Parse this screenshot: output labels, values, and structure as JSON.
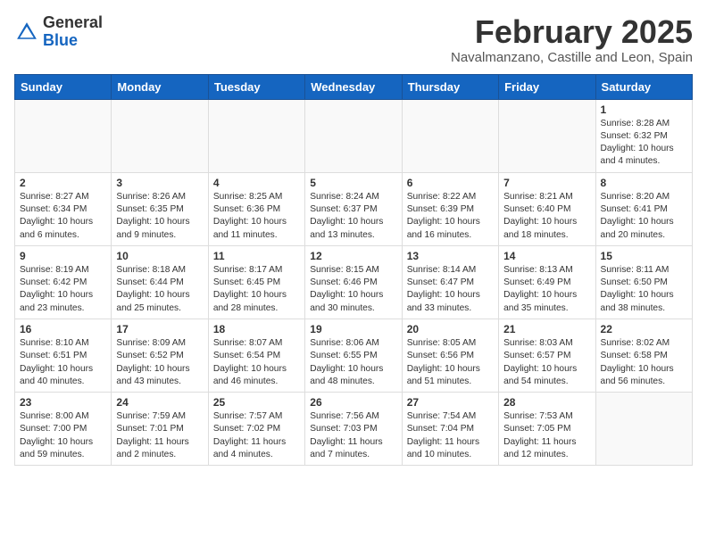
{
  "header": {
    "logo_general": "General",
    "logo_blue": "Blue",
    "month": "February 2025",
    "location": "Navalmanzano, Castille and Leon, Spain"
  },
  "weekdays": [
    "Sunday",
    "Monday",
    "Tuesday",
    "Wednesday",
    "Thursday",
    "Friday",
    "Saturday"
  ],
  "weeks": [
    [
      {
        "day": "",
        "info": ""
      },
      {
        "day": "",
        "info": ""
      },
      {
        "day": "",
        "info": ""
      },
      {
        "day": "",
        "info": ""
      },
      {
        "day": "",
        "info": ""
      },
      {
        "day": "",
        "info": ""
      },
      {
        "day": "1",
        "info": "Sunrise: 8:28 AM\nSunset: 6:32 PM\nDaylight: 10 hours\nand 4 minutes."
      }
    ],
    [
      {
        "day": "2",
        "info": "Sunrise: 8:27 AM\nSunset: 6:34 PM\nDaylight: 10 hours\nand 6 minutes."
      },
      {
        "day": "3",
        "info": "Sunrise: 8:26 AM\nSunset: 6:35 PM\nDaylight: 10 hours\nand 9 minutes."
      },
      {
        "day": "4",
        "info": "Sunrise: 8:25 AM\nSunset: 6:36 PM\nDaylight: 10 hours\nand 11 minutes."
      },
      {
        "day": "5",
        "info": "Sunrise: 8:24 AM\nSunset: 6:37 PM\nDaylight: 10 hours\nand 13 minutes."
      },
      {
        "day": "6",
        "info": "Sunrise: 8:22 AM\nSunset: 6:39 PM\nDaylight: 10 hours\nand 16 minutes."
      },
      {
        "day": "7",
        "info": "Sunrise: 8:21 AM\nSunset: 6:40 PM\nDaylight: 10 hours\nand 18 minutes."
      },
      {
        "day": "8",
        "info": "Sunrise: 8:20 AM\nSunset: 6:41 PM\nDaylight: 10 hours\nand 20 minutes."
      }
    ],
    [
      {
        "day": "9",
        "info": "Sunrise: 8:19 AM\nSunset: 6:42 PM\nDaylight: 10 hours\nand 23 minutes."
      },
      {
        "day": "10",
        "info": "Sunrise: 8:18 AM\nSunset: 6:44 PM\nDaylight: 10 hours\nand 25 minutes."
      },
      {
        "day": "11",
        "info": "Sunrise: 8:17 AM\nSunset: 6:45 PM\nDaylight: 10 hours\nand 28 minutes."
      },
      {
        "day": "12",
        "info": "Sunrise: 8:15 AM\nSunset: 6:46 PM\nDaylight: 10 hours\nand 30 minutes."
      },
      {
        "day": "13",
        "info": "Sunrise: 8:14 AM\nSunset: 6:47 PM\nDaylight: 10 hours\nand 33 minutes."
      },
      {
        "day": "14",
        "info": "Sunrise: 8:13 AM\nSunset: 6:49 PM\nDaylight: 10 hours\nand 35 minutes."
      },
      {
        "day": "15",
        "info": "Sunrise: 8:11 AM\nSunset: 6:50 PM\nDaylight: 10 hours\nand 38 minutes."
      }
    ],
    [
      {
        "day": "16",
        "info": "Sunrise: 8:10 AM\nSunset: 6:51 PM\nDaylight: 10 hours\nand 40 minutes."
      },
      {
        "day": "17",
        "info": "Sunrise: 8:09 AM\nSunset: 6:52 PM\nDaylight: 10 hours\nand 43 minutes."
      },
      {
        "day": "18",
        "info": "Sunrise: 8:07 AM\nSunset: 6:54 PM\nDaylight: 10 hours\nand 46 minutes."
      },
      {
        "day": "19",
        "info": "Sunrise: 8:06 AM\nSunset: 6:55 PM\nDaylight: 10 hours\nand 48 minutes."
      },
      {
        "day": "20",
        "info": "Sunrise: 8:05 AM\nSunset: 6:56 PM\nDaylight: 10 hours\nand 51 minutes."
      },
      {
        "day": "21",
        "info": "Sunrise: 8:03 AM\nSunset: 6:57 PM\nDaylight: 10 hours\nand 54 minutes."
      },
      {
        "day": "22",
        "info": "Sunrise: 8:02 AM\nSunset: 6:58 PM\nDaylight: 10 hours\nand 56 minutes."
      }
    ],
    [
      {
        "day": "23",
        "info": "Sunrise: 8:00 AM\nSunset: 7:00 PM\nDaylight: 10 hours\nand 59 minutes."
      },
      {
        "day": "24",
        "info": "Sunrise: 7:59 AM\nSunset: 7:01 PM\nDaylight: 11 hours\nand 2 minutes."
      },
      {
        "day": "25",
        "info": "Sunrise: 7:57 AM\nSunset: 7:02 PM\nDaylight: 11 hours\nand 4 minutes."
      },
      {
        "day": "26",
        "info": "Sunrise: 7:56 AM\nSunset: 7:03 PM\nDaylight: 11 hours\nand 7 minutes."
      },
      {
        "day": "27",
        "info": "Sunrise: 7:54 AM\nSunset: 7:04 PM\nDaylight: 11 hours\nand 10 minutes."
      },
      {
        "day": "28",
        "info": "Sunrise: 7:53 AM\nSunset: 7:05 PM\nDaylight: 11 hours\nand 12 minutes."
      },
      {
        "day": "",
        "info": ""
      }
    ]
  ]
}
